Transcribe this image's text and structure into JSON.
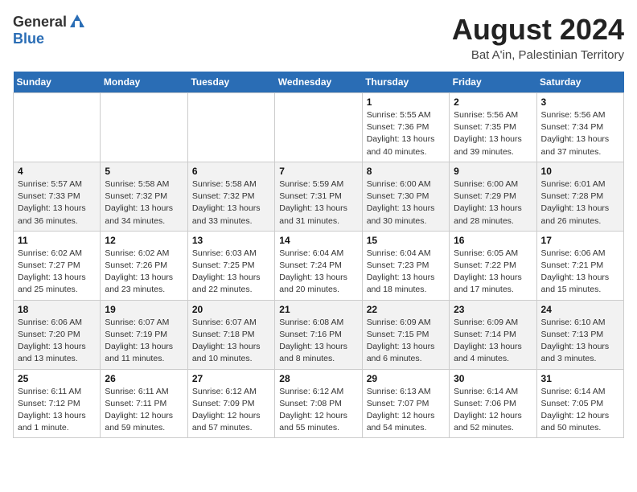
{
  "header": {
    "logo_general": "General",
    "logo_blue": "Blue",
    "main_title": "August 2024",
    "subtitle": "Bat A'in, Palestinian Territory"
  },
  "calendar": {
    "days_of_week": [
      "Sunday",
      "Monday",
      "Tuesday",
      "Wednesday",
      "Thursday",
      "Friday",
      "Saturday"
    ],
    "weeks": [
      [
        {
          "day": "",
          "info": ""
        },
        {
          "day": "",
          "info": ""
        },
        {
          "day": "",
          "info": ""
        },
        {
          "day": "",
          "info": ""
        },
        {
          "day": "1",
          "info": "Sunrise: 5:55 AM\nSunset: 7:36 PM\nDaylight: 13 hours\nand 40 minutes."
        },
        {
          "day": "2",
          "info": "Sunrise: 5:56 AM\nSunset: 7:35 PM\nDaylight: 13 hours\nand 39 minutes."
        },
        {
          "day": "3",
          "info": "Sunrise: 5:56 AM\nSunset: 7:34 PM\nDaylight: 13 hours\nand 37 minutes."
        }
      ],
      [
        {
          "day": "4",
          "info": "Sunrise: 5:57 AM\nSunset: 7:33 PM\nDaylight: 13 hours\nand 36 minutes."
        },
        {
          "day": "5",
          "info": "Sunrise: 5:58 AM\nSunset: 7:32 PM\nDaylight: 13 hours\nand 34 minutes."
        },
        {
          "day": "6",
          "info": "Sunrise: 5:58 AM\nSunset: 7:32 PM\nDaylight: 13 hours\nand 33 minutes."
        },
        {
          "day": "7",
          "info": "Sunrise: 5:59 AM\nSunset: 7:31 PM\nDaylight: 13 hours\nand 31 minutes."
        },
        {
          "day": "8",
          "info": "Sunrise: 6:00 AM\nSunset: 7:30 PM\nDaylight: 13 hours\nand 30 minutes."
        },
        {
          "day": "9",
          "info": "Sunrise: 6:00 AM\nSunset: 7:29 PM\nDaylight: 13 hours\nand 28 minutes."
        },
        {
          "day": "10",
          "info": "Sunrise: 6:01 AM\nSunset: 7:28 PM\nDaylight: 13 hours\nand 26 minutes."
        }
      ],
      [
        {
          "day": "11",
          "info": "Sunrise: 6:02 AM\nSunset: 7:27 PM\nDaylight: 13 hours\nand 25 minutes."
        },
        {
          "day": "12",
          "info": "Sunrise: 6:02 AM\nSunset: 7:26 PM\nDaylight: 13 hours\nand 23 minutes."
        },
        {
          "day": "13",
          "info": "Sunrise: 6:03 AM\nSunset: 7:25 PM\nDaylight: 13 hours\nand 22 minutes."
        },
        {
          "day": "14",
          "info": "Sunrise: 6:04 AM\nSunset: 7:24 PM\nDaylight: 13 hours\nand 20 minutes."
        },
        {
          "day": "15",
          "info": "Sunrise: 6:04 AM\nSunset: 7:23 PM\nDaylight: 13 hours\nand 18 minutes."
        },
        {
          "day": "16",
          "info": "Sunrise: 6:05 AM\nSunset: 7:22 PM\nDaylight: 13 hours\nand 17 minutes."
        },
        {
          "day": "17",
          "info": "Sunrise: 6:06 AM\nSunset: 7:21 PM\nDaylight: 13 hours\nand 15 minutes."
        }
      ],
      [
        {
          "day": "18",
          "info": "Sunrise: 6:06 AM\nSunset: 7:20 PM\nDaylight: 13 hours\nand 13 minutes."
        },
        {
          "day": "19",
          "info": "Sunrise: 6:07 AM\nSunset: 7:19 PM\nDaylight: 13 hours\nand 11 minutes."
        },
        {
          "day": "20",
          "info": "Sunrise: 6:07 AM\nSunset: 7:18 PM\nDaylight: 13 hours\nand 10 minutes."
        },
        {
          "day": "21",
          "info": "Sunrise: 6:08 AM\nSunset: 7:16 PM\nDaylight: 13 hours\nand 8 minutes."
        },
        {
          "day": "22",
          "info": "Sunrise: 6:09 AM\nSunset: 7:15 PM\nDaylight: 13 hours\nand 6 minutes."
        },
        {
          "day": "23",
          "info": "Sunrise: 6:09 AM\nSunset: 7:14 PM\nDaylight: 13 hours\nand 4 minutes."
        },
        {
          "day": "24",
          "info": "Sunrise: 6:10 AM\nSunset: 7:13 PM\nDaylight: 13 hours\nand 3 minutes."
        }
      ],
      [
        {
          "day": "25",
          "info": "Sunrise: 6:11 AM\nSunset: 7:12 PM\nDaylight: 13 hours\nand 1 minute."
        },
        {
          "day": "26",
          "info": "Sunrise: 6:11 AM\nSunset: 7:11 PM\nDaylight: 12 hours\nand 59 minutes."
        },
        {
          "day": "27",
          "info": "Sunrise: 6:12 AM\nSunset: 7:09 PM\nDaylight: 12 hours\nand 57 minutes."
        },
        {
          "day": "28",
          "info": "Sunrise: 6:12 AM\nSunset: 7:08 PM\nDaylight: 12 hours\nand 55 minutes."
        },
        {
          "day": "29",
          "info": "Sunrise: 6:13 AM\nSunset: 7:07 PM\nDaylight: 12 hours\nand 54 minutes."
        },
        {
          "day": "30",
          "info": "Sunrise: 6:14 AM\nSunset: 7:06 PM\nDaylight: 12 hours\nand 52 minutes."
        },
        {
          "day": "31",
          "info": "Sunrise: 6:14 AM\nSunset: 7:05 PM\nDaylight: 12 hours\nand 50 minutes."
        }
      ]
    ]
  }
}
